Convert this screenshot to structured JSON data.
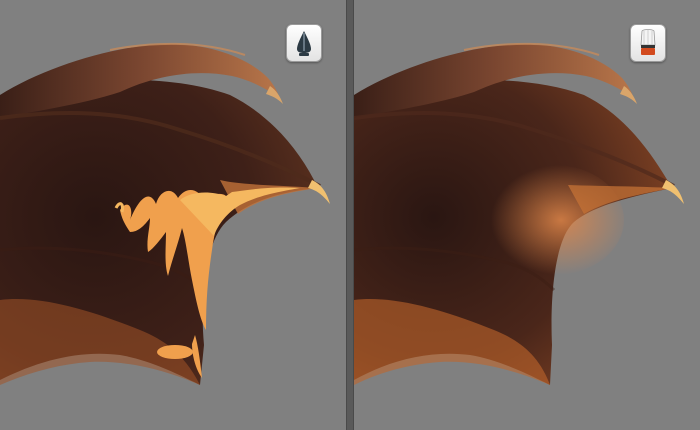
{
  "panels": [
    {
      "id": "left",
      "tool_icon": "pen-nib-icon",
      "description_visible": false
    },
    {
      "id": "right",
      "tool_icon": "brush-icon",
      "description_visible": false
    }
  ],
  "colors": {
    "background": "#808080",
    "divider": "#5a5a5a",
    "wing_dark": "#2a1612",
    "wing_mid": "#6b3a22",
    "wing_highlight": "#f2a352",
    "claw": "#f0c070",
    "brush_handle": "#d24a1e"
  }
}
